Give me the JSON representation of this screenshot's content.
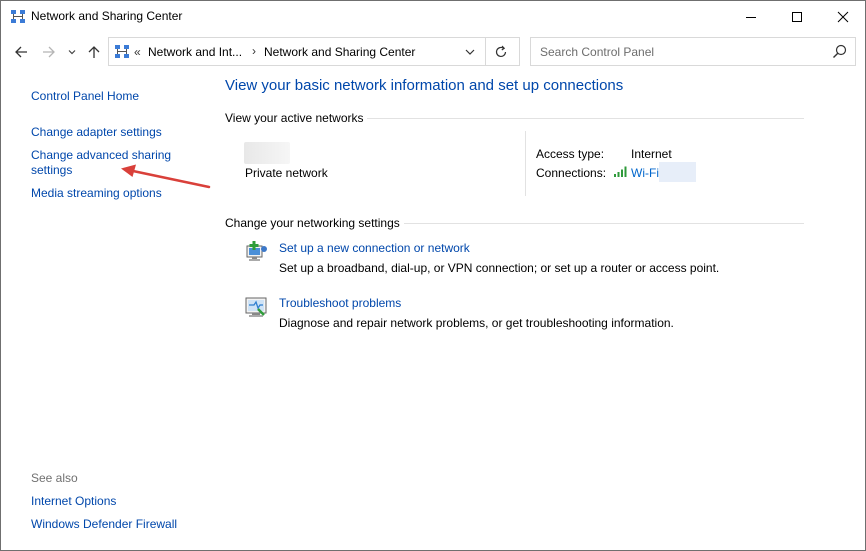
{
  "window": {
    "title": "Network and Sharing Center"
  },
  "navigation": {
    "address_chevron": "«",
    "address_segments": [
      "Network and Int...",
      "Network and Sharing Center"
    ],
    "address_separator": "›",
    "search_placeholder": "Search Control Panel"
  },
  "left_pane": {
    "home_link": "Control Panel Home",
    "links": [
      "Change adapter settings",
      "Change advanced sharing settings",
      "Media streaming options"
    ],
    "see_also_heading": "See also",
    "see_also_links": [
      "Internet Options",
      "Windows Defender Firewall"
    ]
  },
  "main": {
    "title": "View your basic network information and set up connections",
    "active_networks_heading": "View your active networks",
    "network_name": "Private network",
    "access_type_label": "Access type:",
    "access_type_value": "Internet",
    "connections_label": "Connections:",
    "connection_name": "Wi-Fi",
    "change_settings_heading": "Change your networking settings",
    "tasks": [
      {
        "icon": "new-connection-icon",
        "title": "Set up a new connection or network",
        "description": "Set up a broadband, dial-up, or VPN connection; or set up a router or access point."
      },
      {
        "icon": "troubleshoot-icon",
        "title": "Troubleshoot problems",
        "description": "Diagnose and repair network problems, or get troubleshooting information."
      }
    ]
  },
  "colors": {
    "link": "#0047ab",
    "annotation_arrow": "#d9403a"
  }
}
